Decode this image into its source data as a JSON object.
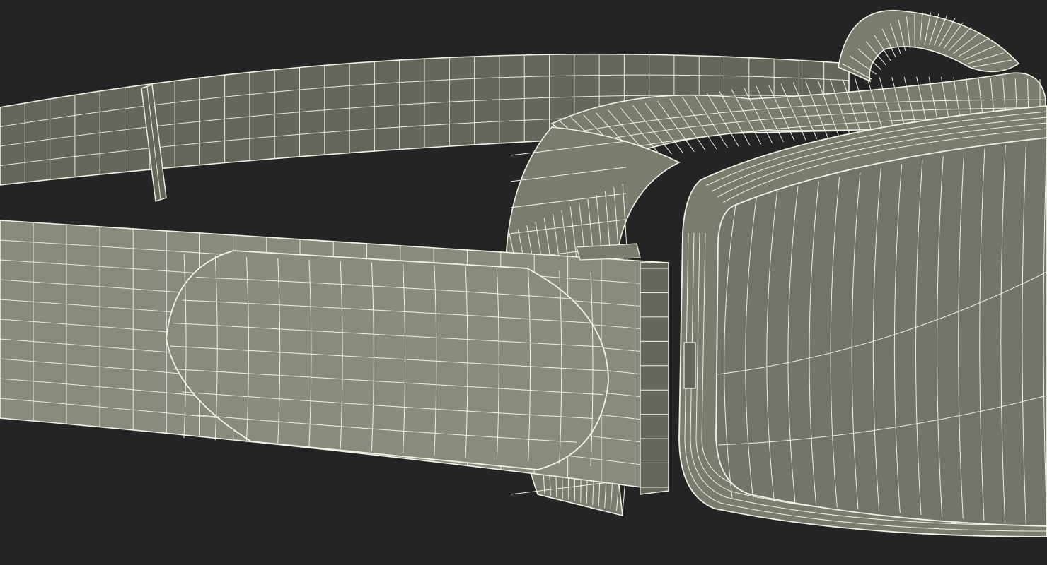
{
  "scene": {
    "subject": "goggles-wireframe",
    "colors": {
      "background": "#242424",
      "surface": "#7b7c70",
      "surface_dark": "#66675c",
      "surface_light": "#8a8b7f",
      "wire": "#f2f2e6"
    }
  }
}
